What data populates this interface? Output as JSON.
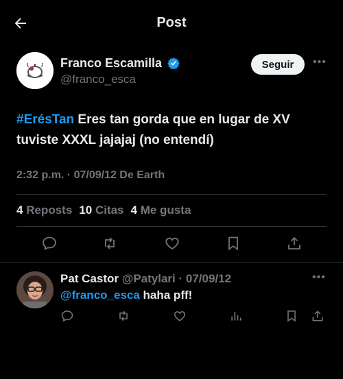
{
  "header": {
    "title": "Post"
  },
  "post": {
    "author": {
      "name": "Franco Escamilla",
      "handle": "@franco_esca",
      "verified": true
    },
    "follow_label": "Seguir",
    "hashtag": "#ErésTan",
    "text": "  Eres tan gorda que en lugar de XV tuviste XXXL  jajajaj (no entendí)",
    "meta": "2:32 p.m. · 07/09/12 De Earth",
    "stats": {
      "reposts_count": "4",
      "reposts_label": "Reposts",
      "quotes_count": "10",
      "quotes_label": "Citas",
      "likes_count": "4",
      "likes_label": "Me gusta"
    },
    "actions": [
      "reply-icon",
      "repost-icon",
      "like-icon",
      "bookmark-icon",
      "share-icon"
    ]
  },
  "reply": {
    "name": "Pat Castor",
    "handle_date": " @Patylari · 07/09/12",
    "mention": "@franco_esca",
    "text": " haha pff!",
    "actions": [
      "reply-icon",
      "repost-icon",
      "like-icon",
      "views-icon",
      "bookmark-icon",
      "share-icon"
    ]
  },
  "colors": {
    "background": "#000000",
    "text": "#e7e9ea",
    "secondary": "#71767b",
    "accent": "#1d9bf0",
    "divider": "#2f3336"
  }
}
